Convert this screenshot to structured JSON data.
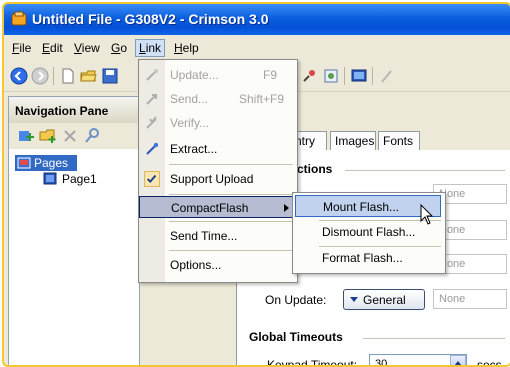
{
  "window": {
    "title": "Untitled File - G308V2 - Crimson 3.0",
    "colors": {
      "titlebar": "#0a5fe0",
      "frame": "#f2c832",
      "selection": "#316ac5"
    }
  },
  "menubar": {
    "items": [
      {
        "label": "File"
      },
      {
        "label": "Edit"
      },
      {
        "label": "View"
      },
      {
        "label": "Go"
      },
      {
        "label": "Link"
      },
      {
        "label": "Help"
      }
    ]
  },
  "toolbar": {
    "icons": [
      "back-icon",
      "forward-icon",
      "new-file-icon",
      "open-folder-icon",
      "save-icon",
      "tool-icon",
      "tool2-icon",
      "display-icon",
      "wand-icon"
    ]
  },
  "nav_pane": {
    "title": "Navigation Pane",
    "tree": [
      {
        "label": "Pages"
      },
      {
        "label": "Page1"
      }
    ]
  },
  "editor": {
    "tabs": [
      {
        "label": "ntry"
      },
      {
        "label": "Images"
      },
      {
        "label": "Fonts"
      }
    ],
    "section1": "ctions",
    "fields": [
      "None",
      "None",
      "None"
    ],
    "on_update": {
      "label": "On Update:",
      "button": "General",
      "value": "None"
    },
    "section2": "Global Timeouts",
    "keypad": {
      "label": "Keypad Timeout:",
      "value": "30",
      "unit": "secs"
    }
  },
  "link_menu": {
    "items": [
      {
        "label": "Update...",
        "shortcut": "F9",
        "disabled": true
      },
      {
        "label": "Send...",
        "shortcut": "Shift+F9",
        "disabled": true
      },
      {
        "label": "Verify...",
        "shortcut": "",
        "disabled": true
      },
      {
        "label": "Extract...",
        "shortcut": "",
        "disabled": false
      },
      {
        "label": "Support Upload",
        "shortcut": "",
        "disabled": false,
        "checked": true
      },
      {
        "label": "CompactFlash",
        "shortcut": "",
        "disabled": false,
        "submenu": true
      },
      {
        "label": "Send Time...",
        "shortcut": "",
        "disabled": false
      },
      {
        "label": "Options...",
        "shortcut": "",
        "disabled": false
      }
    ]
  },
  "compactflash_submenu": {
    "items": [
      {
        "label": "Mount Flash..."
      },
      {
        "label": "Dismount Flash..."
      },
      {
        "label": "Format Flash..."
      }
    ]
  }
}
